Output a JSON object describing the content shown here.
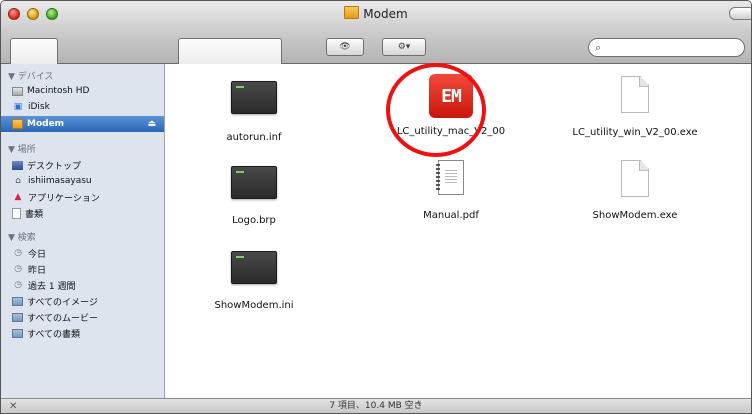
{
  "window": {
    "title": "Modem"
  },
  "toolbar": {
    "back_icon": "◀",
    "forward_icon": "▶",
    "view_icon_icons": "▦",
    "view_icon_list": "☰",
    "view_icon_columns": "▥",
    "view_icon_coverflow": "▬",
    "quicklook_icon": "👁",
    "action_icon": "⚙▾",
    "search_placeholder": "",
    "search_icon": "⌕"
  },
  "sidebar": {
    "devices_header": "▼ デバイス",
    "places_header": "▼ 場所",
    "search_header": "▼ 検索",
    "devices": [
      {
        "label": "Macintosh HD",
        "icon": "hard-drive-icon"
      },
      {
        "label": "iDisk",
        "icon": "idisk-icon"
      },
      {
        "label": "Modem",
        "icon": "modem-drive-icon",
        "selected": true,
        "eject": "⏏"
      }
    ],
    "places": [
      {
        "label": "デスクトップ",
        "icon": "desktop-icon"
      },
      {
        "label": "ishiimasayasu",
        "icon": "home-icon"
      },
      {
        "label": "アプリケーション",
        "icon": "applications-icon"
      },
      {
        "label": "書類",
        "icon": "documents-icon"
      }
    ],
    "searches": [
      {
        "label": "今日",
        "icon": "clock-icon"
      },
      {
        "label": "昨日",
        "icon": "clock-icon"
      },
      {
        "label": "過去 1 週間",
        "icon": "clock-icon"
      },
      {
        "label": "すべてのイメージ",
        "icon": "smart-folder-icon"
      },
      {
        "label": "すべてのムービー",
        "icon": "smart-folder-icon"
      },
      {
        "label": "すべての書類",
        "icon": "smart-folder-icon"
      }
    ]
  },
  "files": [
    {
      "name": "autorun.inf",
      "icon": "terminal-file-icon"
    },
    {
      "name": "LC_utility_mac_V2_00",
      "icon": "em-app-icon",
      "app_glyph": "EM"
    },
    {
      "name": "LC_utility_win_V2_00.exe",
      "icon": "document-icon"
    },
    {
      "name": "Logo.brp",
      "icon": "terminal-file-icon"
    },
    {
      "name": "Manual.pdf",
      "icon": "pdf-icon"
    },
    {
      "name": "ShowModem.exe",
      "icon": "document-icon"
    },
    {
      "name": "ShowModem.ini",
      "icon": "terminal-file-icon"
    }
  ],
  "annotation": {
    "highlight_color": "#ee1111",
    "highlighted_item": "LC_utility_mac_V2_00"
  },
  "status": {
    "text": "7 項目、10.4 MB 空き",
    "resize_icon": "✕"
  },
  "colors": {
    "sidebar_bg": "#dde4ee",
    "selection": "#2c65b6",
    "app_icon": "#e02a1c"
  }
}
